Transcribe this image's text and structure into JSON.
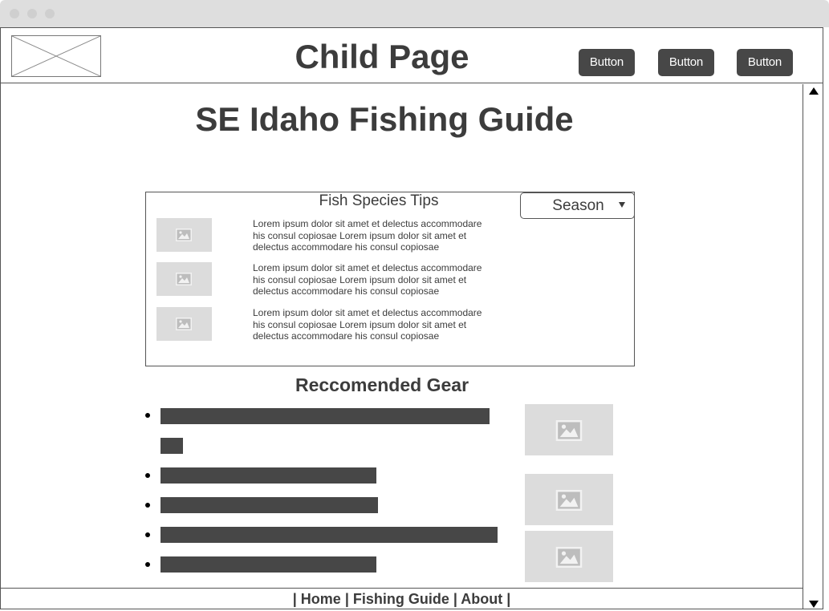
{
  "window": {
    "title_bar_dots": 3
  },
  "header": {
    "title": "Child Page",
    "buttons": [
      "Button",
      "Button",
      "Button"
    ]
  },
  "main": {
    "title": "SE Idaho Fishing Guide",
    "tips_panel": {
      "title": "Fish Species Tips",
      "season_dropdown": {
        "value": "Season"
      },
      "tips": [
        {
          "text": "Lorem ipsum dolor sit amet et delectus accommodare his consul copiosae Lorem ipsum dolor sit amet et delectus accommodare his consul copiosae"
        },
        {
          "text": "Lorem ipsum dolor sit amet et delectus accommodare his consul copiosae Lorem ipsum dolor sit amet et delectus accommodare his consul copiosae"
        },
        {
          "text": "Lorem ipsum dolor sit amet et delectus accommodare his consul copiosae Lorem ipsum dolor sit amet et delectus accommodare his consul copiosae"
        }
      ]
    },
    "gear": {
      "title": "Reccomended Gear",
      "items": 5
    }
  },
  "footer": {
    "text": "| Home | Fishing Guide | About |"
  },
  "colors": {
    "dark_fill": "#474747",
    "placeholder_fill": "#dcdcdc",
    "text": "#3c3c3c",
    "titlebar": "#dedede"
  }
}
